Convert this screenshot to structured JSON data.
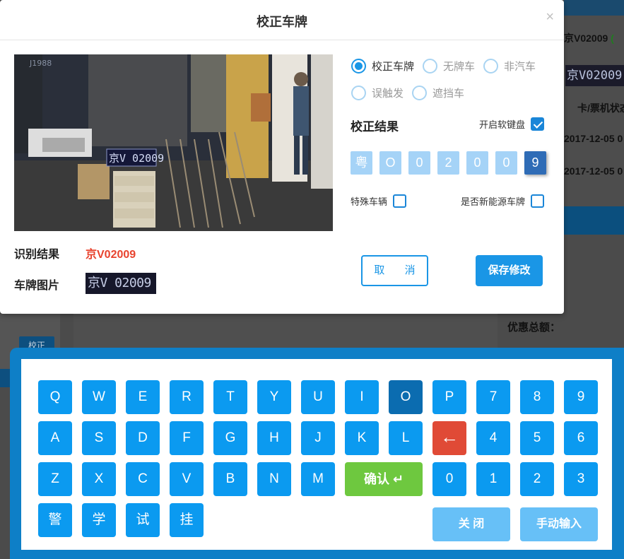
{
  "background": {
    "plate_top": "京V02009",
    "plate_top_tag": "(",
    "plate_image_text": "京V02009",
    "status_label": "卡/票机状态",
    "time1": "2017-12-05 0",
    "time2": "2017-12-05 0",
    "correct_button": "校正",
    "discount_label": "优惠总额："
  },
  "dialog": {
    "title": "校正车牌",
    "close": "×",
    "snapshot_plate_text": "京V 02009",
    "snapshot_corner_text": "J1988",
    "recognition_label": "识别结果",
    "recognition_value": "京V02009",
    "plate_image_label": "车牌图片",
    "plate_image_text": "京V 02009",
    "options": [
      {
        "label": "校正车牌",
        "checked": true
      },
      {
        "label": "无牌车",
        "checked": false
      },
      {
        "label": "非汽车",
        "checked": false
      },
      {
        "label": "误触发",
        "checked": false
      },
      {
        "label": "遮挡车",
        "checked": false
      }
    ],
    "result_title": "校正结果",
    "soft_keyboard_label": "开启软键盘",
    "soft_keyboard_checked": true,
    "plate_chars": [
      "粤",
      "O",
      "0",
      "2",
      "0",
      "0",
      "9"
    ],
    "active_char_index": 6,
    "special_vehicle_label": "特殊车辆",
    "new_energy_label": "是否新能源车牌",
    "cancel_label": "取 消",
    "save_label": "保存修改"
  },
  "keyboard": {
    "row1": [
      "Q",
      "W",
      "E",
      "R",
      "T",
      "Y",
      "U",
      "I",
      "O",
      "P",
      "7",
      "8",
      "9"
    ],
    "row2": [
      "A",
      "S",
      "D",
      "F",
      "G",
      "H",
      "J",
      "K",
      "L",
      "←",
      "4",
      "5",
      "6"
    ],
    "row3": [
      "Z",
      "X",
      "C",
      "V",
      "B",
      "N",
      "M",
      "0",
      "1",
      "2",
      "3"
    ],
    "confirm_label": "确认 ↵",
    "row4": [
      "警",
      "学",
      "试",
      "挂"
    ],
    "close_label": "关 闭",
    "manual_label": "手动输入",
    "pressed_key": "O"
  }
}
